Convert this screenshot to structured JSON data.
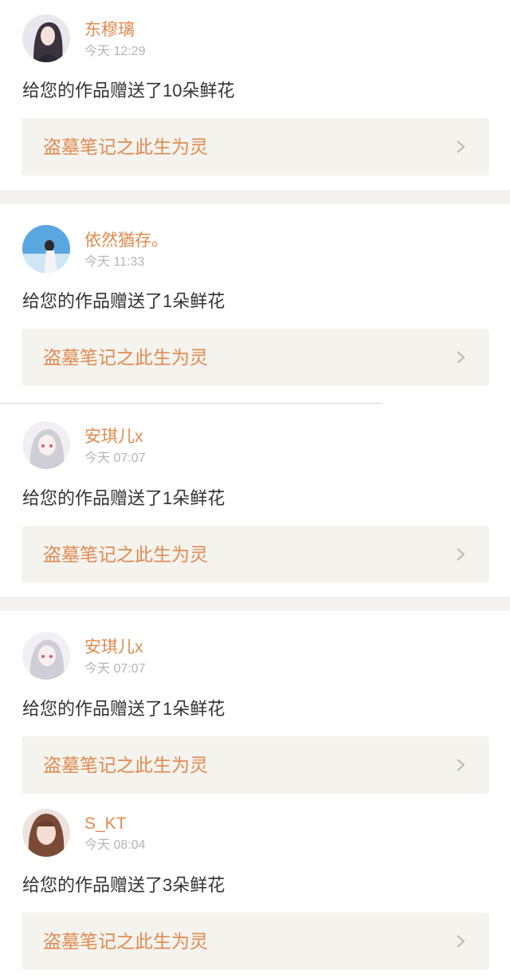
{
  "notifications": [
    {
      "username": "东穆璃",
      "time": "今天 12:29",
      "message": "给您的作品赠送了10朵鲜花",
      "work_title": "盗墓笔记之此生为灵"
    },
    {
      "username": "依然猶存。",
      "time": "今天 11:33",
      "message": "给您的作品赠送了1朵鲜花",
      "work_title": "盗墓笔记之此生为灵"
    },
    {
      "username": "安琪儿x",
      "time": "今天 07:07",
      "message": "给您的作品赠送了1朵鲜花",
      "work_title": "盗墓笔记之此生为灵"
    },
    {
      "username": "安琪儿x",
      "time": "今天 07:07",
      "message": "给您的作品赠送了1朵鲜花",
      "work_title": "盗墓笔记之此生为灵"
    },
    {
      "username": "S_KT",
      "time": "今天 08:04",
      "message": "给您的作品赠送了3朵鲜花",
      "work_title": "盗墓笔记之此生为灵"
    }
  ],
  "colors": {
    "accent": "#e08a4f",
    "card_bg": "#f5f3ee",
    "separator": "#f4f2f0",
    "time_text": "#b5b5b5",
    "body_text": "#333333"
  },
  "icons": {
    "chevron": "chevron-right-icon"
  }
}
